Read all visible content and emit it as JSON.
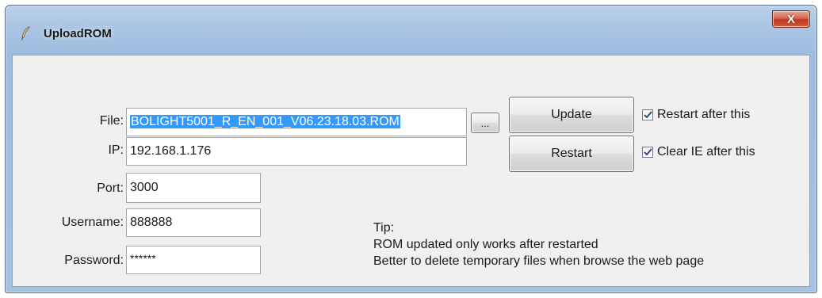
{
  "window": {
    "title": "UploadROM",
    "close_glyph": "X"
  },
  "form": {
    "file_label": "File:",
    "file_value": "BOLIGHT5001_R_EN_001_V06.23.18.03.ROM",
    "browse_label": "...",
    "ip_label": "IP:",
    "ip_value": "192.168.1.176",
    "port_label": "Port:",
    "port_value": "3000",
    "username_label": "Username:",
    "username_value": "888888",
    "password_label": "Password:",
    "password_value": "******"
  },
  "actions": {
    "update_label": "Update",
    "restart_label": "Restart",
    "restart_after_label": "Restart after this",
    "restart_after_checked": true,
    "clear_ie_label": "Clear IE after this",
    "clear_ie_checked": true
  },
  "tip": {
    "heading": "Tip:",
    "line1": "ROM updated only works after restarted",
    "line2": "Better to delete temporary files when browse the web page"
  },
  "icons": {
    "title": "pen-feather-icon",
    "close": "close-icon",
    "check": "checkmark-icon"
  },
  "colors": {
    "selection": "#3399ff",
    "check": "#2b4a8c",
    "close": "#c1361c"
  }
}
